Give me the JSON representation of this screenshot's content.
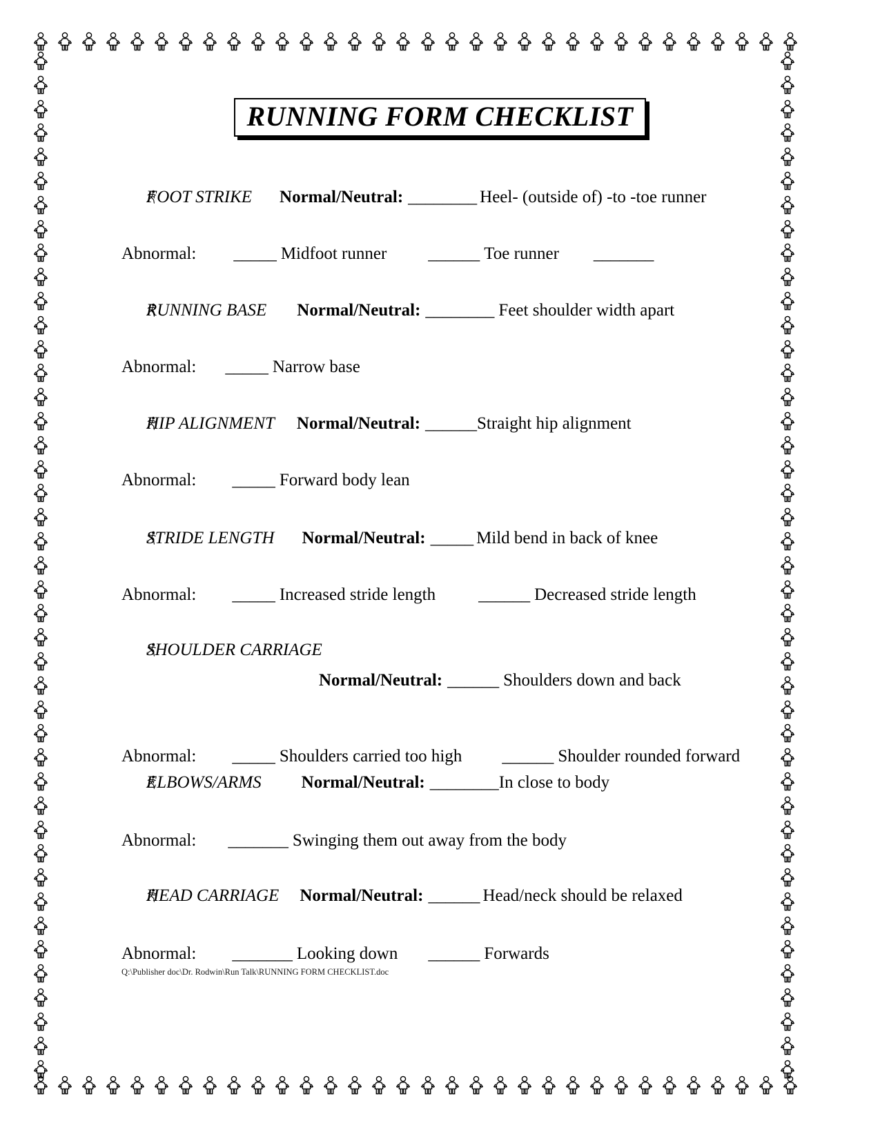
{
  "document": {
    "title": "RUNNING FORM CHECKLIST",
    "footer_path": "Q:\\Publisher doc\\Dr. Rodwin\\Run Talk\\RUNNING FORM CHECKLIST.doc",
    "bullet_icon": "running-person-icon",
    "border_icon": "standing-person-icon",
    "normal_label": "Normal/Neutral:",
    "abnormal_label": "Abnormal:",
    "colors": {
      "text": "#000000",
      "page_background": "#ffffff",
      "title_border": "#000000",
      "title_shadow": "#000000"
    }
  },
  "sections": [
    {
      "name": "FOOT STRIKE",
      "normal_label": "Normal/Neutral:",
      "normal_blank": "________",
      "normal_desc": "Heel- (outside of) -to -toe runner",
      "abnormal_label": "Abnormal:",
      "abnormal_options": [
        {
          "blank": "_____",
          "text": "Midfoot runner"
        },
        {
          "blank": "______",
          "text": "Toe runner"
        },
        {
          "blank": "_______",
          "text": ""
        }
      ],
      "stacked": false
    },
    {
      "name": "RUNNING BASE",
      "normal_label": "Normal/Neutral:",
      "normal_blank": "________",
      "normal_desc": "Feet shoulder width apart",
      "abnormal_label": "Abnormal:",
      "abnormal_options": [
        {
          "blank": "_____",
          "text": "Narrow base"
        }
      ],
      "stacked": false
    },
    {
      "name": "HIP ALIGNMENT",
      "normal_label": "Normal/Neutral:",
      "normal_blank": "______",
      "normal_desc": "Straight hip alignment",
      "abnormal_label": "Abnormal:",
      "abnormal_options": [
        {
          "blank": "_____",
          "text": "Forward body lean"
        }
      ],
      "stacked": false
    },
    {
      "name": "STRIDE LENGTH",
      "normal_label": "Normal/Neutral:",
      "normal_blank": "_____",
      "normal_desc": "Mild bend in back of knee",
      "abnormal_label": "Abnormal:",
      "abnormal_options": [
        {
          "blank": "_____",
          "text": "Increased stride length"
        },
        {
          "blank": "______",
          "text": "Decreased stride length"
        }
      ],
      "stacked": false
    },
    {
      "name": "SHOULDER CARRIAGE",
      "normal_label": "Normal/Neutral:",
      "normal_blank": "______",
      "normal_desc": "Shoulders down and back",
      "abnormal_label": "Abnormal:",
      "abnormal_options": [
        {
          "blank": "_____",
          "text": "Shoulders carried too high"
        },
        {
          "blank": "______",
          "text": "Shoulder rounded forward"
        }
      ],
      "stacked": true
    },
    {
      "name": "ELBOWS/ARMS",
      "normal_label": "Normal/Neutral:",
      "normal_blank": "________",
      "normal_desc": "In close to body",
      "abnormal_label": "Abnormal:",
      "abnormal_options": [
        {
          "blank": "_______",
          "text": "Swinging them out away from the body"
        }
      ],
      "stacked": false
    },
    {
      "name": "HEAD CARRIAGE",
      "normal_label": "Normal/Neutral:",
      "normal_blank": "______",
      "normal_desc": "Head/neck should be relaxed",
      "abnormal_label": "Abnormal:",
      "abnormal_options": [
        {
          "blank": "_______",
          "text": "Looking down"
        },
        {
          "blank": "______",
          "text": "Forwards"
        }
      ],
      "stacked": false
    }
  ]
}
